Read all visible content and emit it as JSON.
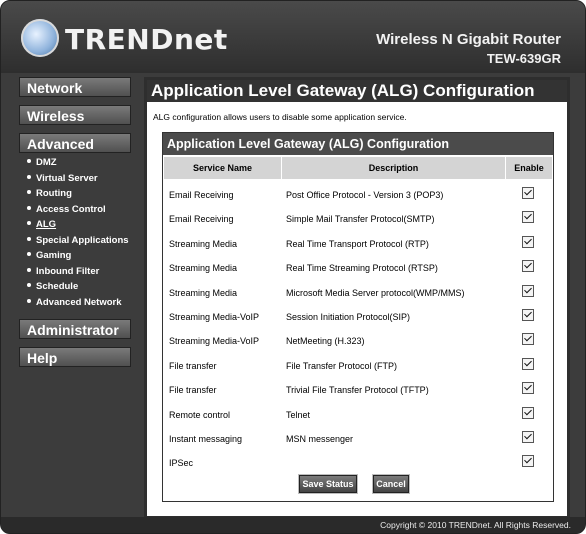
{
  "header": {
    "brand": "TRENDnet",
    "product_name": "Wireless N Gigabit Router",
    "model": "TEW-639GR"
  },
  "sidebar": {
    "menus": [
      {
        "label": "Network"
      },
      {
        "label": "Wireless"
      },
      {
        "label": "Advanced"
      },
      {
        "label": "Administrator"
      },
      {
        "label": "Help"
      }
    ],
    "advanced_items": [
      {
        "label": "DMZ"
      },
      {
        "label": "Virtual Server"
      },
      {
        "label": "Routing"
      },
      {
        "label": "Access Control"
      },
      {
        "label": "ALG",
        "active": true
      },
      {
        "label": "Special Applications"
      },
      {
        "label": "Gaming"
      },
      {
        "label": "Inbound Filter"
      },
      {
        "label": "Schedule"
      },
      {
        "label": "Advanced Network"
      }
    ]
  },
  "main": {
    "title": "Application Level Gateway (ALG) Configuration",
    "description": "ALG configuration allows users to disable some application service.",
    "table": {
      "title": "Application Level Gateway (ALG) Configuration",
      "columns": [
        "Service Name",
        "Description",
        "Enable"
      ],
      "rows": [
        {
          "service": "Email Receiving",
          "description": "Post Office Protocol - Version 3 (POP3)",
          "enabled": true
        },
        {
          "service": "Email Receiving",
          "description": "Simple Mail Transfer Protocol(SMTP)",
          "enabled": true
        },
        {
          "service": "Streaming Media",
          "description": "Real Time Transport Protocol (RTP)",
          "enabled": true
        },
        {
          "service": "Streaming Media",
          "description": "Real Time Streaming Protocol (RTSP)",
          "enabled": true
        },
        {
          "service": "Streaming Media",
          "description": "Microsoft Media Server protocol(WMP/MMS)",
          "enabled": true
        },
        {
          "service": "Streaming Media-VoIP",
          "description": "Session Initiation Protocol(SIP)",
          "enabled": true
        },
        {
          "service": "Streaming Media-VoIP",
          "description": "NetMeeting (H.323)",
          "enabled": true
        },
        {
          "service": "File transfer",
          "description": "File Transfer Protocol (FTP)",
          "enabled": true
        },
        {
          "service": "File transfer",
          "description": "Trivial File Transfer Protocol (TFTP)",
          "enabled": true
        },
        {
          "service": "Remote control",
          "description": "Telnet",
          "enabled": true
        },
        {
          "service": "Instant messaging",
          "description": "MSN messenger",
          "enabled": true
        },
        {
          "service": "IPSec",
          "description": "",
          "enabled": true
        }
      ]
    },
    "buttons": {
      "save": "Save Status",
      "cancel": "Cancel"
    }
  },
  "footer": {
    "copyright": "Copyright © 2010 TRENDnet. All Rights Reserved."
  }
}
